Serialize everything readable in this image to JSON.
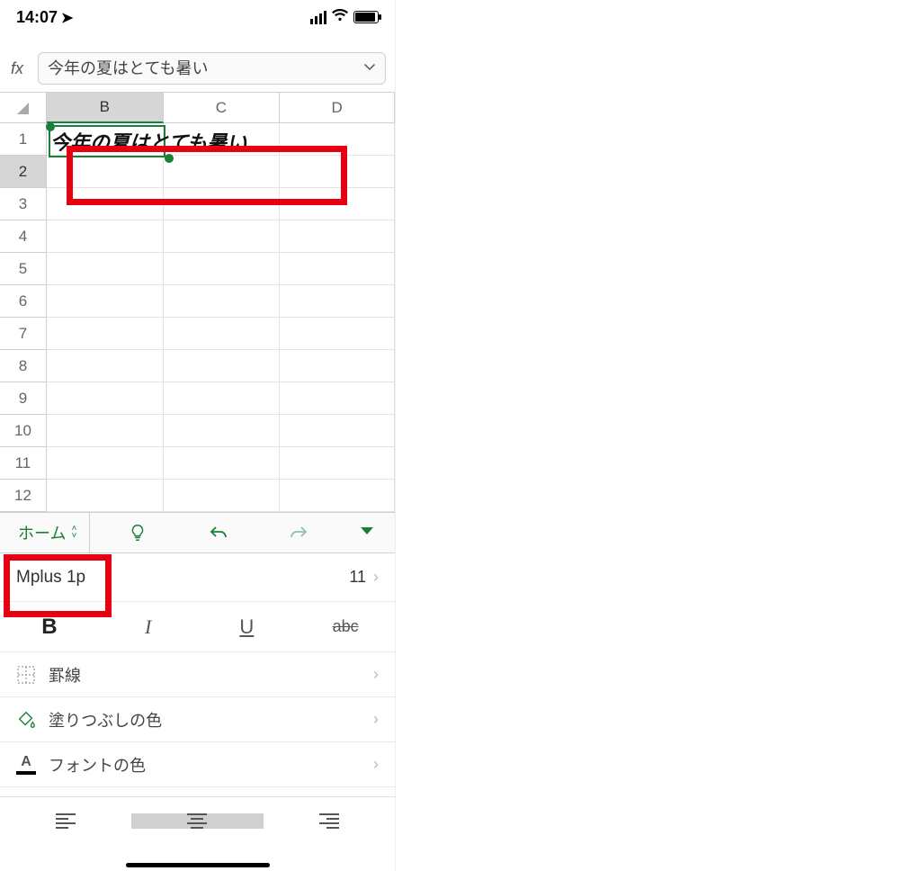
{
  "status": {
    "time": "14:07"
  },
  "formula": {
    "fx": "fx",
    "value": "今年の夏はとても暑い"
  },
  "columns": [
    "B",
    "C",
    "D"
  ],
  "rows": [
    "1",
    "2",
    "3",
    "4",
    "5",
    "6",
    "7",
    "8",
    "9",
    "10",
    "11",
    "12"
  ],
  "selected_cell_text": "今年の夏はとても暑い",
  "tab": {
    "name": "ホーム"
  },
  "format": {
    "font_name": "Mplus 1p",
    "font_size": "11",
    "bold": "B",
    "italic": "I",
    "underline": "U",
    "strike": "abc",
    "borders": "罫線",
    "fill": "塗りつぶしの色",
    "fontcolor": "フォントの色",
    "fontcolor_glyph": "A"
  }
}
